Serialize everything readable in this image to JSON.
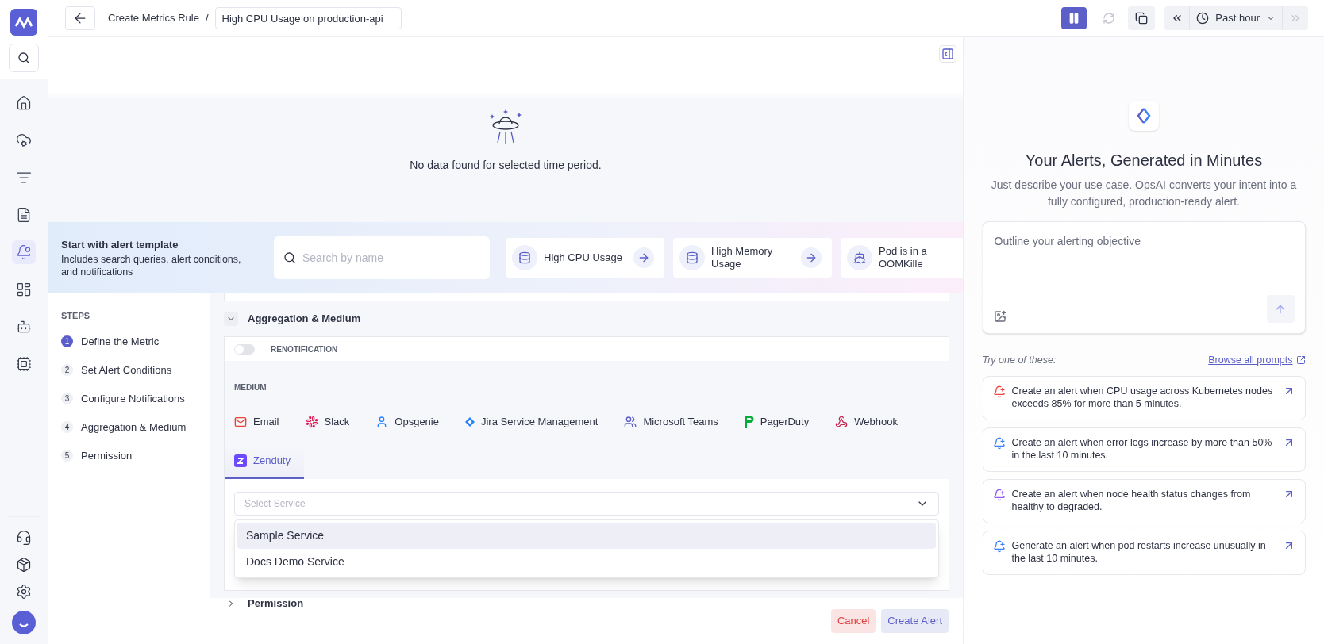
{
  "topbar": {
    "breadcrumb": "Create Metrics Rule",
    "separator": "/",
    "rule_name": "High CPU Usage on production-api",
    "paused": true,
    "time_range": "Past hour"
  },
  "chart": {
    "empty_message": "No data found for selected time period."
  },
  "template_bar": {
    "title": "Start with alert template",
    "subtitle": "Includes search queries, alert conditions, and notifications",
    "search": {
      "placeholder": "Search by name"
    },
    "templates": [
      {
        "label": "High CPU Usage",
        "kind": "database"
      },
      {
        "label": "High Memory Usage",
        "kind": "database"
      },
      {
        "label": "Pod is in a OOMKille",
        "kind": "kubernetes"
      }
    ]
  },
  "steps": {
    "heading": "STEPS",
    "items": [
      {
        "number": "1",
        "label": "Define the Metric",
        "selected": true
      },
      {
        "number": "2",
        "label": "Set Alert Conditions",
        "selected": false
      },
      {
        "number": "3",
        "label": "Configure Notifications",
        "selected": false
      },
      {
        "number": "4",
        "label": "Aggregation & Medium",
        "selected": false
      },
      {
        "number": "5",
        "label": "Permission",
        "selected": false
      }
    ]
  },
  "sections": [
    {
      "title": "Aggregation & Medium",
      "expanded": true
    },
    {
      "title": "Permission",
      "expanded": false
    }
  ],
  "renotification": {
    "label": "RENOTIFICATION",
    "on": false
  },
  "medium": {
    "label": "MEDIUM",
    "items": [
      {
        "label": "Email",
        "kind": "email",
        "selected": false
      },
      {
        "label": "Slack",
        "kind": "slack",
        "selected": false
      },
      {
        "label": "Opsgenie",
        "kind": "opsgenie",
        "selected": false
      },
      {
        "label": "Jira Service Management",
        "kind": "jira",
        "selected": false
      },
      {
        "label": "Microsoft Teams",
        "kind": "teams",
        "selected": false
      },
      {
        "label": "PagerDuty",
        "kind": "pagerduty",
        "selected": false
      },
      {
        "label": "Webhook",
        "kind": "webhook",
        "selected": false
      },
      {
        "label": "Zenduty",
        "kind": "zenduty",
        "selected": true
      }
    ]
  },
  "service_select": {
    "placeholder": "Select Service",
    "options": [
      {
        "label": "Sample Service",
        "selected": true
      },
      {
        "label": "Docs Demo Service",
        "selected": false
      }
    ]
  },
  "footer": {
    "cancel": "Cancel",
    "create": "Create Alert"
  },
  "assistant": {
    "title": "Your Alerts, Generated in Minutes",
    "description": "Just describe your use case. OpsAI converts your intent into a fully configured, production-ready alert.",
    "input": {
      "placeholder": "Outline your alerting objective"
    },
    "try_label": "Try one of these:",
    "browse_link": "Browse all prompts",
    "prompts": [
      {
        "text": "Create an alert when CPU usage across Kubernetes nodes exceeds 85% for more than 5 minutes.",
        "color": "#ef4444"
      },
      {
        "text": "Create an alert when error logs increase by more than 50% in the last 10 minutes.",
        "color": "#3b82f6"
      },
      {
        "text": "Create an alert when node health status changes from healthy to degraded.",
        "color": "#8b5cf6"
      },
      {
        "text": "Generate an alert when pod restarts increase unusually in the last 10 minutes.",
        "color": "#3b82f6"
      }
    ]
  }
}
